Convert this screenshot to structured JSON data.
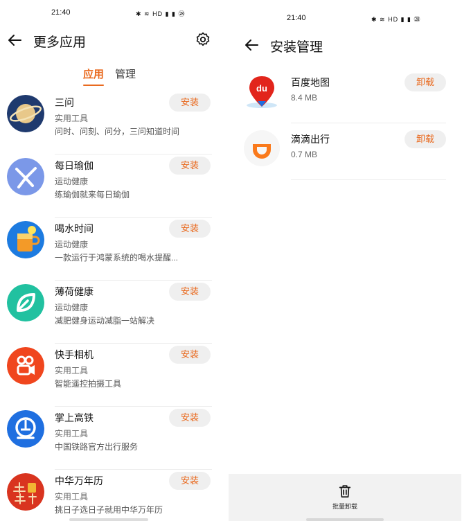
{
  "left": {
    "status": {
      "time": "21:40",
      "icons": "✱ ≋ HD ▮ ▮ ㉘"
    },
    "title": "更多应用",
    "tabs": [
      {
        "label": "应用",
        "active": true
      },
      {
        "label": "管理",
        "active": false
      }
    ],
    "install_label": "安装",
    "apps": [
      {
        "name": "三问",
        "category": "实用工具",
        "desc": "问时、问刻、问分，三问知道时间",
        "icon": "planet-icon"
      },
      {
        "name": "每日瑜伽",
        "category": "运动健康",
        "desc": "练瑜伽就来每日瑜伽",
        "icon": "yoga-icon"
      },
      {
        "name": "喝水时间",
        "category": "运动健康",
        "desc": "一款运行于鸿蒙系统的喝水提醒...",
        "icon": "drink-icon"
      },
      {
        "name": "薄荷健康",
        "category": "运动健康",
        "desc": "减肥健身运动减脂一站解决",
        "icon": "leaf-icon"
      },
      {
        "name": "快手相机",
        "category": "实用工具",
        "desc": "智能遥控拍摄工具",
        "icon": "kuaishou-icon"
      },
      {
        "name": "掌上高铁",
        "category": "实用工具",
        "desc": "中国铁路官方出行服务",
        "icon": "railway-icon"
      },
      {
        "name": "中华万年历",
        "category": "实用工具",
        "desc": "挑日子选日子就用中华万年历",
        "icon": "calendar-icon"
      }
    ],
    "colors": {
      "accent": "#e96a1f"
    }
  },
  "right": {
    "status": {
      "time": "21:40",
      "icons": "✱ ≋ HD ▮ ▮ ㉘"
    },
    "title": "安装管理",
    "uninstall_label": "卸载",
    "apps": [
      {
        "name": "百度地图",
        "size": "8.4 MB",
        "icon": "baidu-map-icon"
      },
      {
        "name": "滴滴出行",
        "size": "0.7 MB",
        "icon": "didi-icon"
      }
    ],
    "bottom": {
      "label": "批量卸载",
      "icon": "trash-icon"
    }
  }
}
